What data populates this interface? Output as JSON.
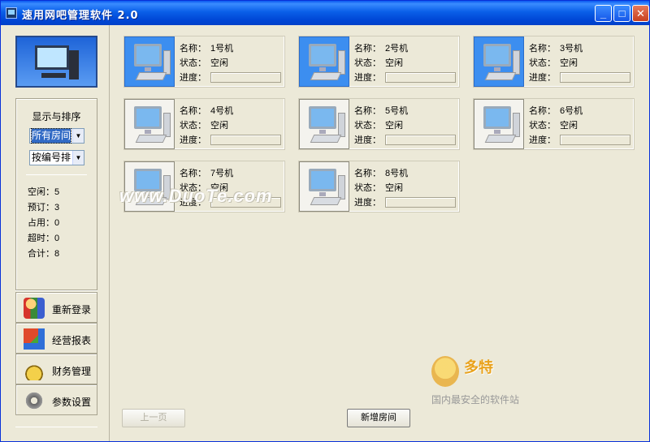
{
  "window": {
    "title": "速用网吧管理软件 2.0",
    "minimize": "_",
    "maximize": "□",
    "close": "✕"
  },
  "sidebar": {
    "sort_title": "显示与排序",
    "filter_select": "所有房间",
    "sort_select": "按编号排",
    "stats": [
      {
        "label": "空闲：",
        "value": "5"
      },
      {
        "label": "预订：",
        "value": "3"
      },
      {
        "label": "占用：",
        "value": "0"
      },
      {
        "label": "超时：",
        "value": "0"
      },
      {
        "label": "合计：",
        "value": "8"
      }
    ],
    "nav": [
      {
        "label": "重新登录",
        "icon": "users-icon"
      },
      {
        "label": "经营报表",
        "icon": "report-icon"
      },
      {
        "label": "财务管理",
        "icon": "money-icon"
      },
      {
        "label": "参数设置",
        "icon": "gear-icon"
      }
    ]
  },
  "field_labels": {
    "name": "名称：",
    "status": "状态：",
    "progress": "进度："
  },
  "rooms": [
    {
      "name": "1号机",
      "status": "空闲",
      "active": true,
      "progress": 0
    },
    {
      "name": "2号机",
      "status": "空闲",
      "active": true,
      "progress": 0
    },
    {
      "name": "3号机",
      "status": "空闲",
      "active": true,
      "progress": 0
    },
    {
      "name": "4号机",
      "status": "空闲",
      "active": false,
      "progress": 0
    },
    {
      "name": "5号机",
      "status": "空闲",
      "active": false,
      "progress": 0
    },
    {
      "name": "6号机",
      "status": "空闲",
      "active": false,
      "progress": 0
    },
    {
      "name": "7号机",
      "status": "空闲",
      "active": false,
      "progress": 0
    },
    {
      "name": "8号机",
      "status": "空闲",
      "active": false,
      "progress": 0
    }
  ],
  "footer": {
    "prev_page": "上一页",
    "add_room": "新增房间"
  },
  "watermark": {
    "text": "www.DuoTe.com",
    "badge_title": "多特",
    "badge_sub": "国内最安全的软件站"
  }
}
